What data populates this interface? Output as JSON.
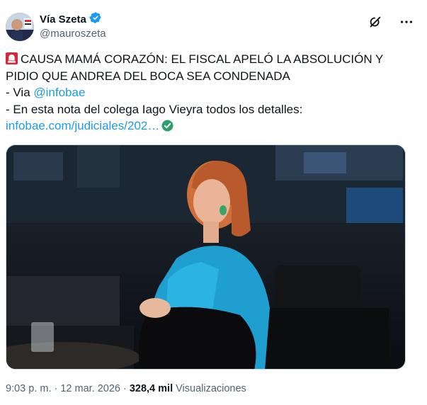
{
  "author": {
    "display_name": "Vía Szeta",
    "handle": "@mauroszeta",
    "verified": true,
    "avatar_icon": "avatar-photo"
  },
  "tweet": {
    "line1": "CAUSA MAMÁ CORAZÓN: EL FISCAL APELÓ LA ABSOLUCIÓN Y",
    "line2": "PIDIO QUE ANDREA DEL BOCA SEA CONDENADA",
    "via_prefix": "- Via ",
    "via_mention": "@infobae",
    "line4": "- En esta nota del colega Iago Vieyra todos los detalles:",
    "link_text": "infobae.com/judiciales/202…"
  },
  "meta": {
    "time": "9:03 p. m.",
    "date": "12 mar. 2026",
    "separator": "·",
    "views_count": "328,4 mil",
    "views_label": "Visualizaciones"
  },
  "colors": {
    "accent": "#1d9bf0",
    "secondary_text": "#536471",
    "verified_badge": "#1d9bf0",
    "link_check": "#2e9e6d",
    "siren": "#e0245e"
  },
  "icons": {
    "verified": "verified-badge-icon",
    "grok": "grok-icon",
    "more": "more-options-icon",
    "siren": "rotating-light-icon",
    "link_check": "check-circle-icon"
  }
}
